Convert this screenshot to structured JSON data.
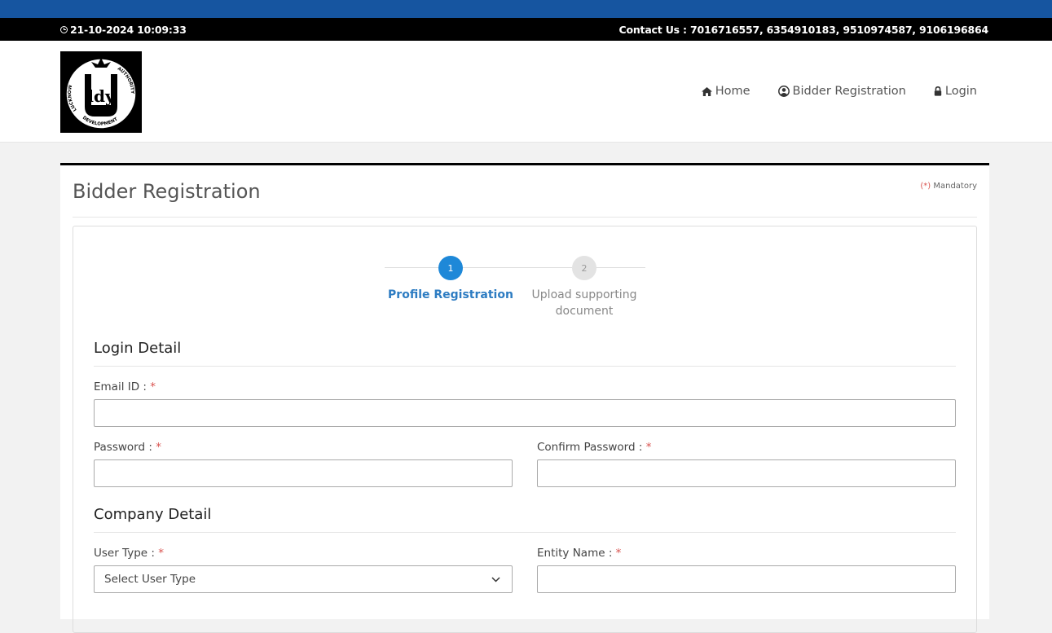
{
  "topbar": {
    "datetime": "21-10-2024 10:09:33",
    "contact": "Contact Us : 7016716557, 6354910183, 9510974587, 9106196864"
  },
  "logo": {
    "text_top_left": "LUCKNOW",
    "text_bottom": "DEVELOPMENT",
    "text_top_right": "AUTHORITY",
    "monogram": "ldy"
  },
  "nav": [
    {
      "label": "Home",
      "icon": "home-icon"
    },
    {
      "label": "Bidder Registration",
      "icon": "user-circle-icon"
    },
    {
      "label": "Login",
      "icon": "lock-icon"
    }
  ],
  "page": {
    "title": "Bidder Registration",
    "mandatory_note_star": "(*)",
    "mandatory_note_label": "Mandatory"
  },
  "stepper": {
    "steps": [
      {
        "number": "1",
        "label": "Profile Registration",
        "active": true
      },
      {
        "number": "2",
        "label": "Upload supporting document",
        "active": false
      }
    ]
  },
  "login_detail": {
    "title": "Login Detail",
    "email_label": "Email ID :",
    "password_label": "Password :",
    "confirm_password_label": "Confirm Password :",
    "required_mark": "*"
  },
  "company_detail": {
    "title": "Company Detail",
    "user_type_label": "User Type :",
    "user_type_value": "Select User Type",
    "entity_name_label": "Entity Name :"
  },
  "colors": {
    "top_strip": "#1655a0",
    "info_bar": "#000000",
    "active_step": "#1e88d8",
    "required": "#d9534f"
  }
}
